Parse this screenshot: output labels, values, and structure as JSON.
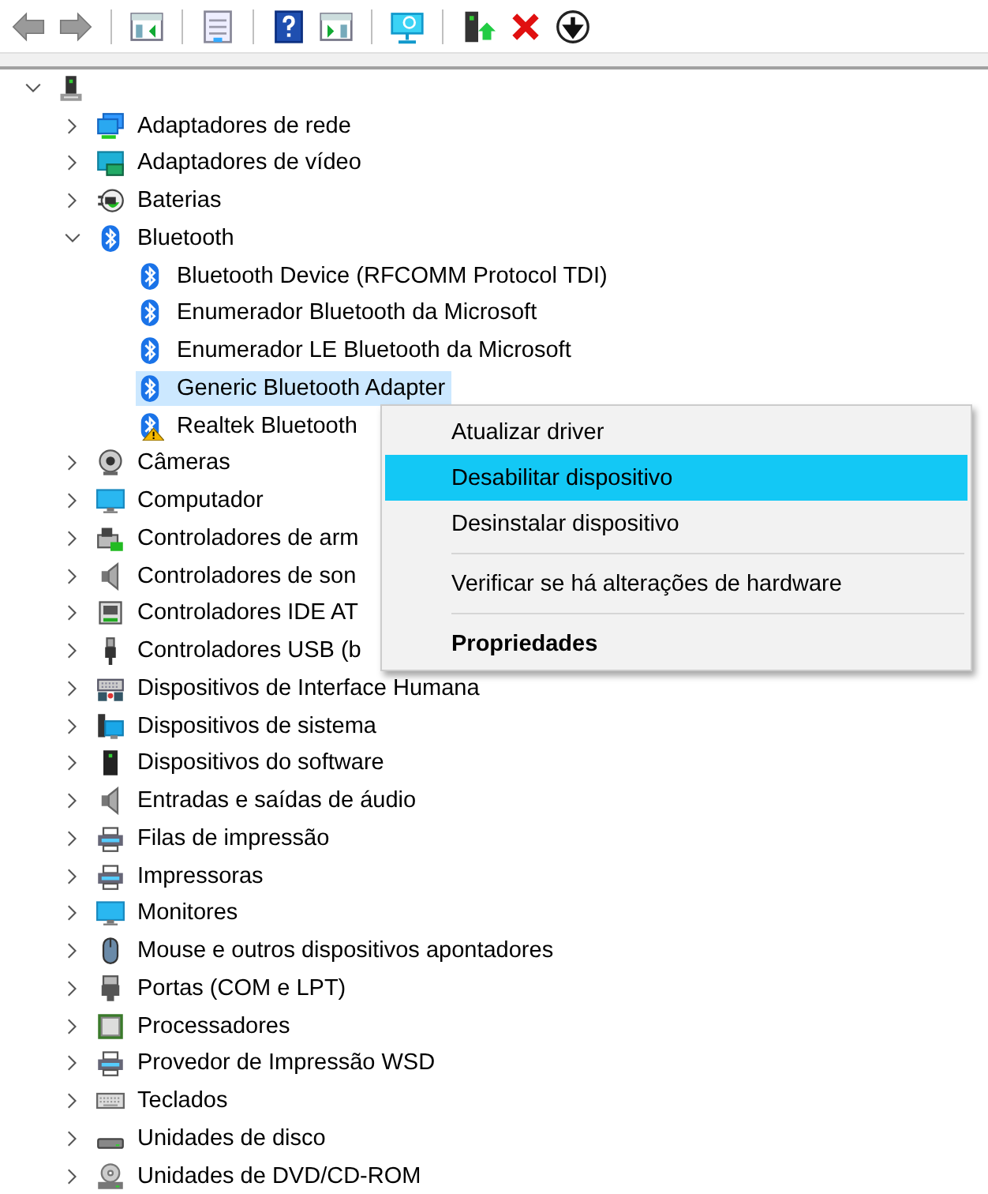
{
  "toolbar": [
    {
      "kind": "back",
      "disabled": true
    },
    {
      "kind": "forward",
      "disabled": true
    },
    {
      "kind": "separator"
    },
    {
      "kind": "panel-left"
    },
    {
      "kind": "separator"
    },
    {
      "kind": "sheet"
    },
    {
      "kind": "separator"
    },
    {
      "kind": "help"
    },
    {
      "kind": "panel-right"
    },
    {
      "kind": "separator"
    },
    {
      "kind": "scan"
    },
    {
      "kind": "separator"
    },
    {
      "kind": "update"
    },
    {
      "kind": "remove"
    },
    {
      "kind": "down"
    }
  ],
  "tree": {
    "kind": "pc",
    "expanded": true,
    "children": [
      {
        "label": "Adaptadores de rede",
        "kind": "network",
        "expanded": false
      },
      {
        "label": "Adaptadores de vídeo",
        "kind": "display",
        "expanded": false
      },
      {
        "label": "Baterias",
        "kind": "battery",
        "expanded": false
      },
      {
        "label": "Bluetooth",
        "kind": "bluetooth",
        "expanded": true,
        "children": [
          {
            "label": "Bluetooth Device (RFCOMM Protocol TDI)",
            "kind": "bluetooth",
            "selected": false,
            "warning": false
          },
          {
            "label": "Enumerador Bluetooth da Microsoft",
            "kind": "bluetooth",
            "selected": false,
            "warning": false
          },
          {
            "label": "Enumerador LE Bluetooth da Microsoft",
            "kind": "bluetooth",
            "selected": false,
            "warning": false
          },
          {
            "label": "Generic Bluetooth Adapter",
            "kind": "bluetooth",
            "selected": true,
            "warning": false
          },
          {
            "label": "Realtek Bluetooth",
            "kind": "bluetooth",
            "selected": false,
            "warning": true
          }
        ]
      },
      {
        "label": "Câmeras",
        "kind": "camera",
        "expanded": false
      },
      {
        "label": "Computador",
        "kind": "monitor",
        "expanded": false
      },
      {
        "label": "Controladores de arm",
        "kind": "storage",
        "expanded": false
      },
      {
        "label": "Controladores de son",
        "kind": "audio",
        "expanded": false
      },
      {
        "label": "Controladores IDE AT",
        "kind": "ide",
        "expanded": false
      },
      {
        "label": "Controladores USB (b",
        "kind": "usb",
        "expanded": false
      },
      {
        "label": "Dispositivos de Interface Humana",
        "kind": "hid",
        "expanded": false
      },
      {
        "label": "Dispositivos de sistema",
        "kind": "system",
        "expanded": false
      },
      {
        "label": "Dispositivos do software",
        "kind": "software",
        "expanded": false
      },
      {
        "label": "Entradas e saídas de áudio",
        "kind": "audio",
        "expanded": false
      },
      {
        "label": "Filas de impressão",
        "kind": "printer",
        "expanded": false
      },
      {
        "label": "Impressoras",
        "kind": "printer",
        "expanded": false
      },
      {
        "label": "Monitores",
        "kind": "monitor",
        "expanded": false
      },
      {
        "label": "Mouse e outros dispositivos apontadores",
        "kind": "mouse",
        "expanded": false
      },
      {
        "label": "Portas (COM e LPT)",
        "kind": "port",
        "expanded": false
      },
      {
        "label": "Processadores",
        "kind": "processor",
        "expanded": false
      },
      {
        "label": "Provedor de Impressão WSD",
        "kind": "printer",
        "expanded": false
      },
      {
        "label": "Teclados",
        "kind": "keyboard",
        "expanded": false
      },
      {
        "label": "Unidades de disco",
        "kind": "disk",
        "expanded": false
      },
      {
        "label": "Unidades de DVD/CD-ROM",
        "kind": "dvd",
        "expanded": false
      }
    ]
  },
  "context_menu": [
    {
      "kind": "item",
      "label": "Atualizar driver",
      "selected": false,
      "default": false
    },
    {
      "kind": "item",
      "label": "Desabilitar dispositivo",
      "selected": true,
      "default": false
    },
    {
      "kind": "item",
      "label": "Desinstalar dispositivo",
      "selected": false,
      "default": false
    },
    {
      "kind": "separator"
    },
    {
      "kind": "item",
      "label": "Verificar se há alterações de hardware",
      "selected": false,
      "default": false
    },
    {
      "kind": "separator"
    },
    {
      "kind": "item",
      "label": "Propriedades",
      "selected": false,
      "default": true
    }
  ]
}
